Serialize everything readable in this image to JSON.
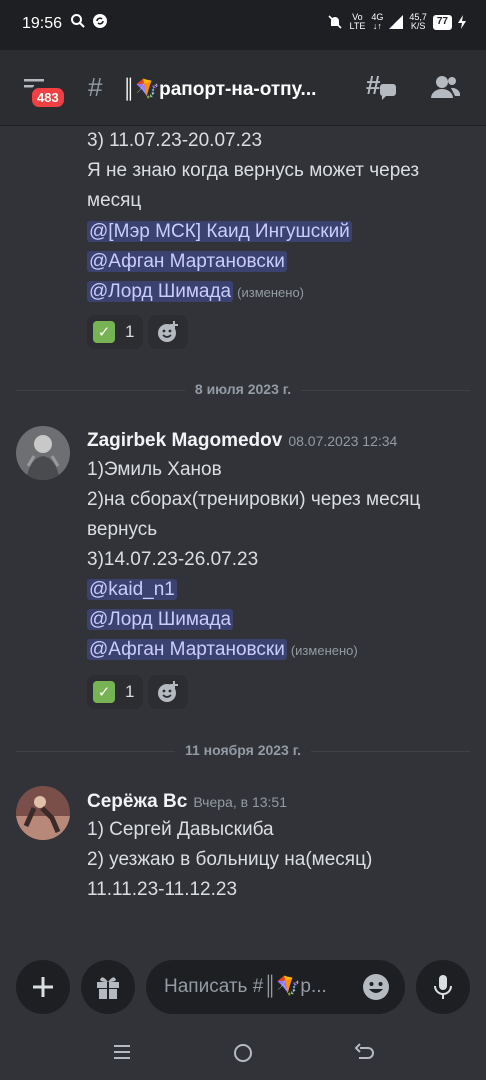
{
  "status_bar": {
    "time": "19:56",
    "network_left": "Vo",
    "network_left2": "LTE",
    "signal": "4G",
    "speed_value": "45,7",
    "speed_unit": "K/S",
    "battery": "77"
  },
  "header": {
    "unread_badge": "483",
    "channel_name": "║🪁рапорт-на-отпу...",
    "icons": [
      "menu-icon",
      "hash-icon",
      "threads-icon",
      "members-icon"
    ]
  },
  "messages": {
    "first": {
      "lines": [
        "3) 11.07.23-20.07.23",
        "Я не знаю когда вернусь может через",
        "месяц"
      ],
      "mentions": [
        "@[Мэр МСК] Каид Ингушский",
        "@Афган Мартановски",
        "@Лорд Шимада"
      ],
      "edited": "(изменено)",
      "reaction_count": "1"
    },
    "divider1": "8 июля 2023 г.",
    "second": {
      "author": "Zagirbek Magomedov",
      "timestamp": "08.07.2023 12:34",
      "lines": [
        "1)Эмиль Ханов",
        "2)на сборах(тренировки) через месяц",
        "вернусь",
        "3)14.07.23-26.07.23"
      ],
      "mentions": [
        "@kaid_n1",
        "@Лорд Шимада",
        "@Афган Мартановски"
      ],
      "edited": "(изменено)",
      "reaction_count": "1"
    },
    "divider2": "11 ноября 2023 г.",
    "third": {
      "author": "Серёжа Вс",
      "timestamp": "Вчера, в 13:51",
      "lines": [
        "1) Сергей Давыскиба",
        "2) уезжаю в больницу на(месяц)",
        "11.11.23-11.12.23"
      ]
    }
  },
  "composer": {
    "placeholder": "Написать #║🪁р..."
  },
  "colors": {
    "background": "#313338",
    "header": "#2b2d31",
    "mention_bg": "#3c4270",
    "mention_text": "#c9cdfb",
    "badge": "#f23f42"
  }
}
